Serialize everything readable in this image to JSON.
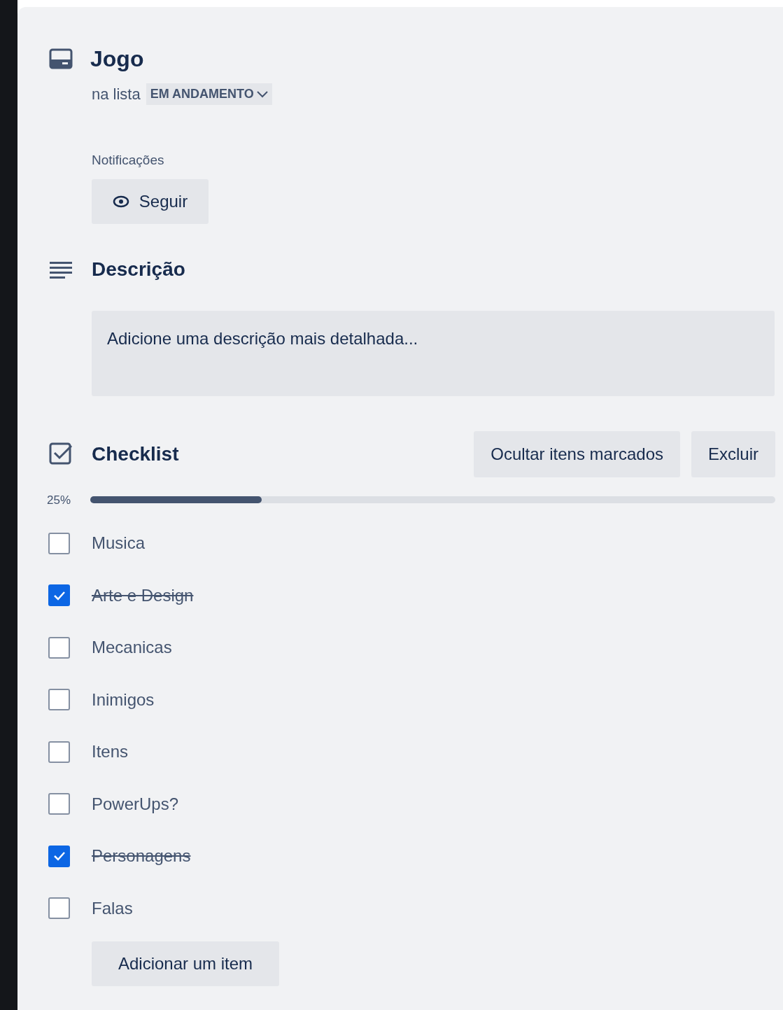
{
  "card": {
    "title": "Jogo",
    "list_prefix": "na lista",
    "list_name": "EM ANDAMENTO"
  },
  "notifications": {
    "label": "Notificações",
    "button": "Seguir"
  },
  "description": {
    "heading": "Descrição",
    "placeholder": "Adicione uma descrição mais detalhada..."
  },
  "checklist": {
    "title": "Checklist",
    "buttons": [
      "Ocultar itens marcados",
      "Excluir"
    ],
    "percent": "25%",
    "level": 0.25,
    "items": [
      {
        "label": "Musica",
        "checked": false
      },
      {
        "label": "Arte e Design",
        "checked": true
      },
      {
        "label": "Mecanicas",
        "checked": false
      },
      {
        "label": "Inimigos",
        "checked": false
      },
      {
        "label": "Itens",
        "checked": false
      },
      {
        "label": "PowerUps?",
        "checked": false
      },
      {
        "label": "Personagens",
        "checked": true
      },
      {
        "label": "Falas",
        "checked": false
      }
    ],
    "add_button": "Adicionar um item"
  }
}
